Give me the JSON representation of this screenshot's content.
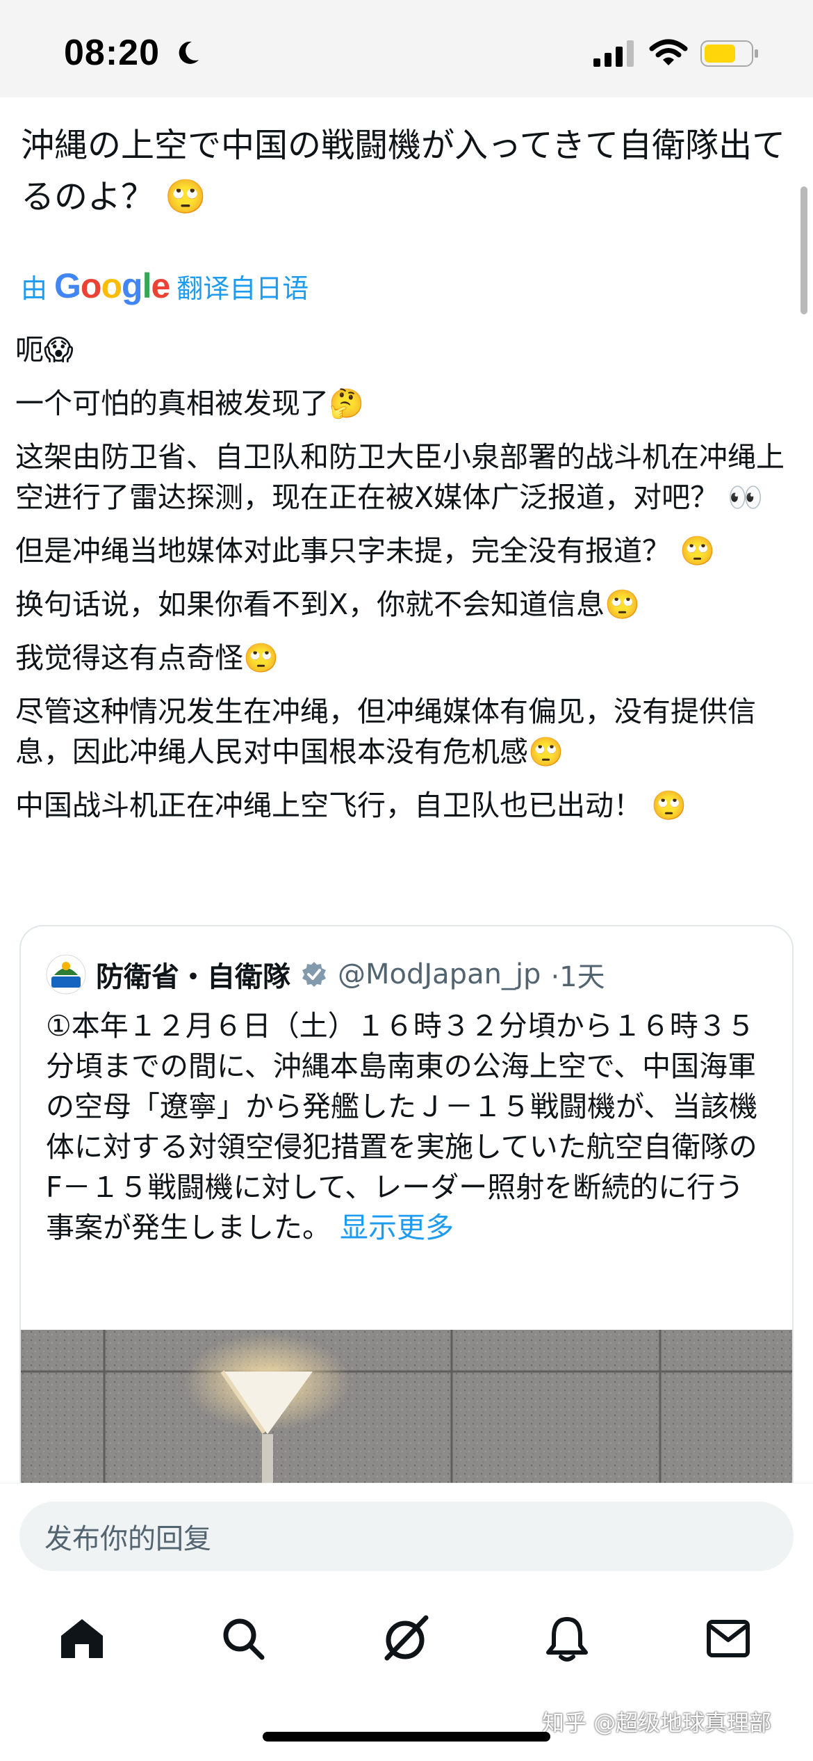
{
  "status_bar": {
    "time": "08:20"
  },
  "post": {
    "text": "沖縄の上空で中国の戦闘機が入ってきて自衛隊出てるのよ？ 🙄",
    "translate_prefix": "由",
    "translate_brand": "Google",
    "translate_suffix": "翻译自日语",
    "paragraphs": [
      "呃😱",
      "一个可怕的真相被发现了🤔",
      "这架由防卫省、自卫队和防卫大臣小泉部署的战斗机在冲绳上空进行了雷达探测，现在正在被X媒体广泛报道，对吧？ 👀",
      "但是冲绳当地媒体对此事只字未提，完全没有报道？ 🙄",
      "换句话说，如果你看不到X，你就不会知道信息🙄",
      "我觉得这有点奇怪🙄",
      "尽管这种情况发生在冲绳，但冲绳媒体有偏见，没有提供信息，因此冲绳人民对中国根本没有危机感🙄",
      "中国战斗机正在冲绳上空飞行，自卫队也已出动！ 🙄"
    ]
  },
  "quote": {
    "author_name": "防衛省・自衛隊",
    "handle": "@ModJapan_jp",
    "time": "·1天",
    "text": "①本年１２月６日（土）１６時３２分頃から１６時３５分頃までの間に、沖縄本島南東の公海上空で、中国海軍の空母「遼寧」から発艦したＪ－１５戦闘機が、当該機体に対する対領空侵犯措置を実施していた航空自衛隊のF－１５戦闘機に対して、レーダー照射を断続的に行う事案が発生しました。",
    "show_more": "显示更多",
    "avatar_label": "防衛省"
  },
  "reply": {
    "placeholder": "发布你的回复"
  },
  "nav": {
    "items": [
      "home-icon",
      "search-icon",
      "grok-icon",
      "notifications-icon",
      "messages-icon"
    ]
  },
  "watermark": "知乎 @超级地球真理部",
  "colors": {
    "accent": "#1d9bf0",
    "text": "#0f1419",
    "secondary": "#536471"
  }
}
